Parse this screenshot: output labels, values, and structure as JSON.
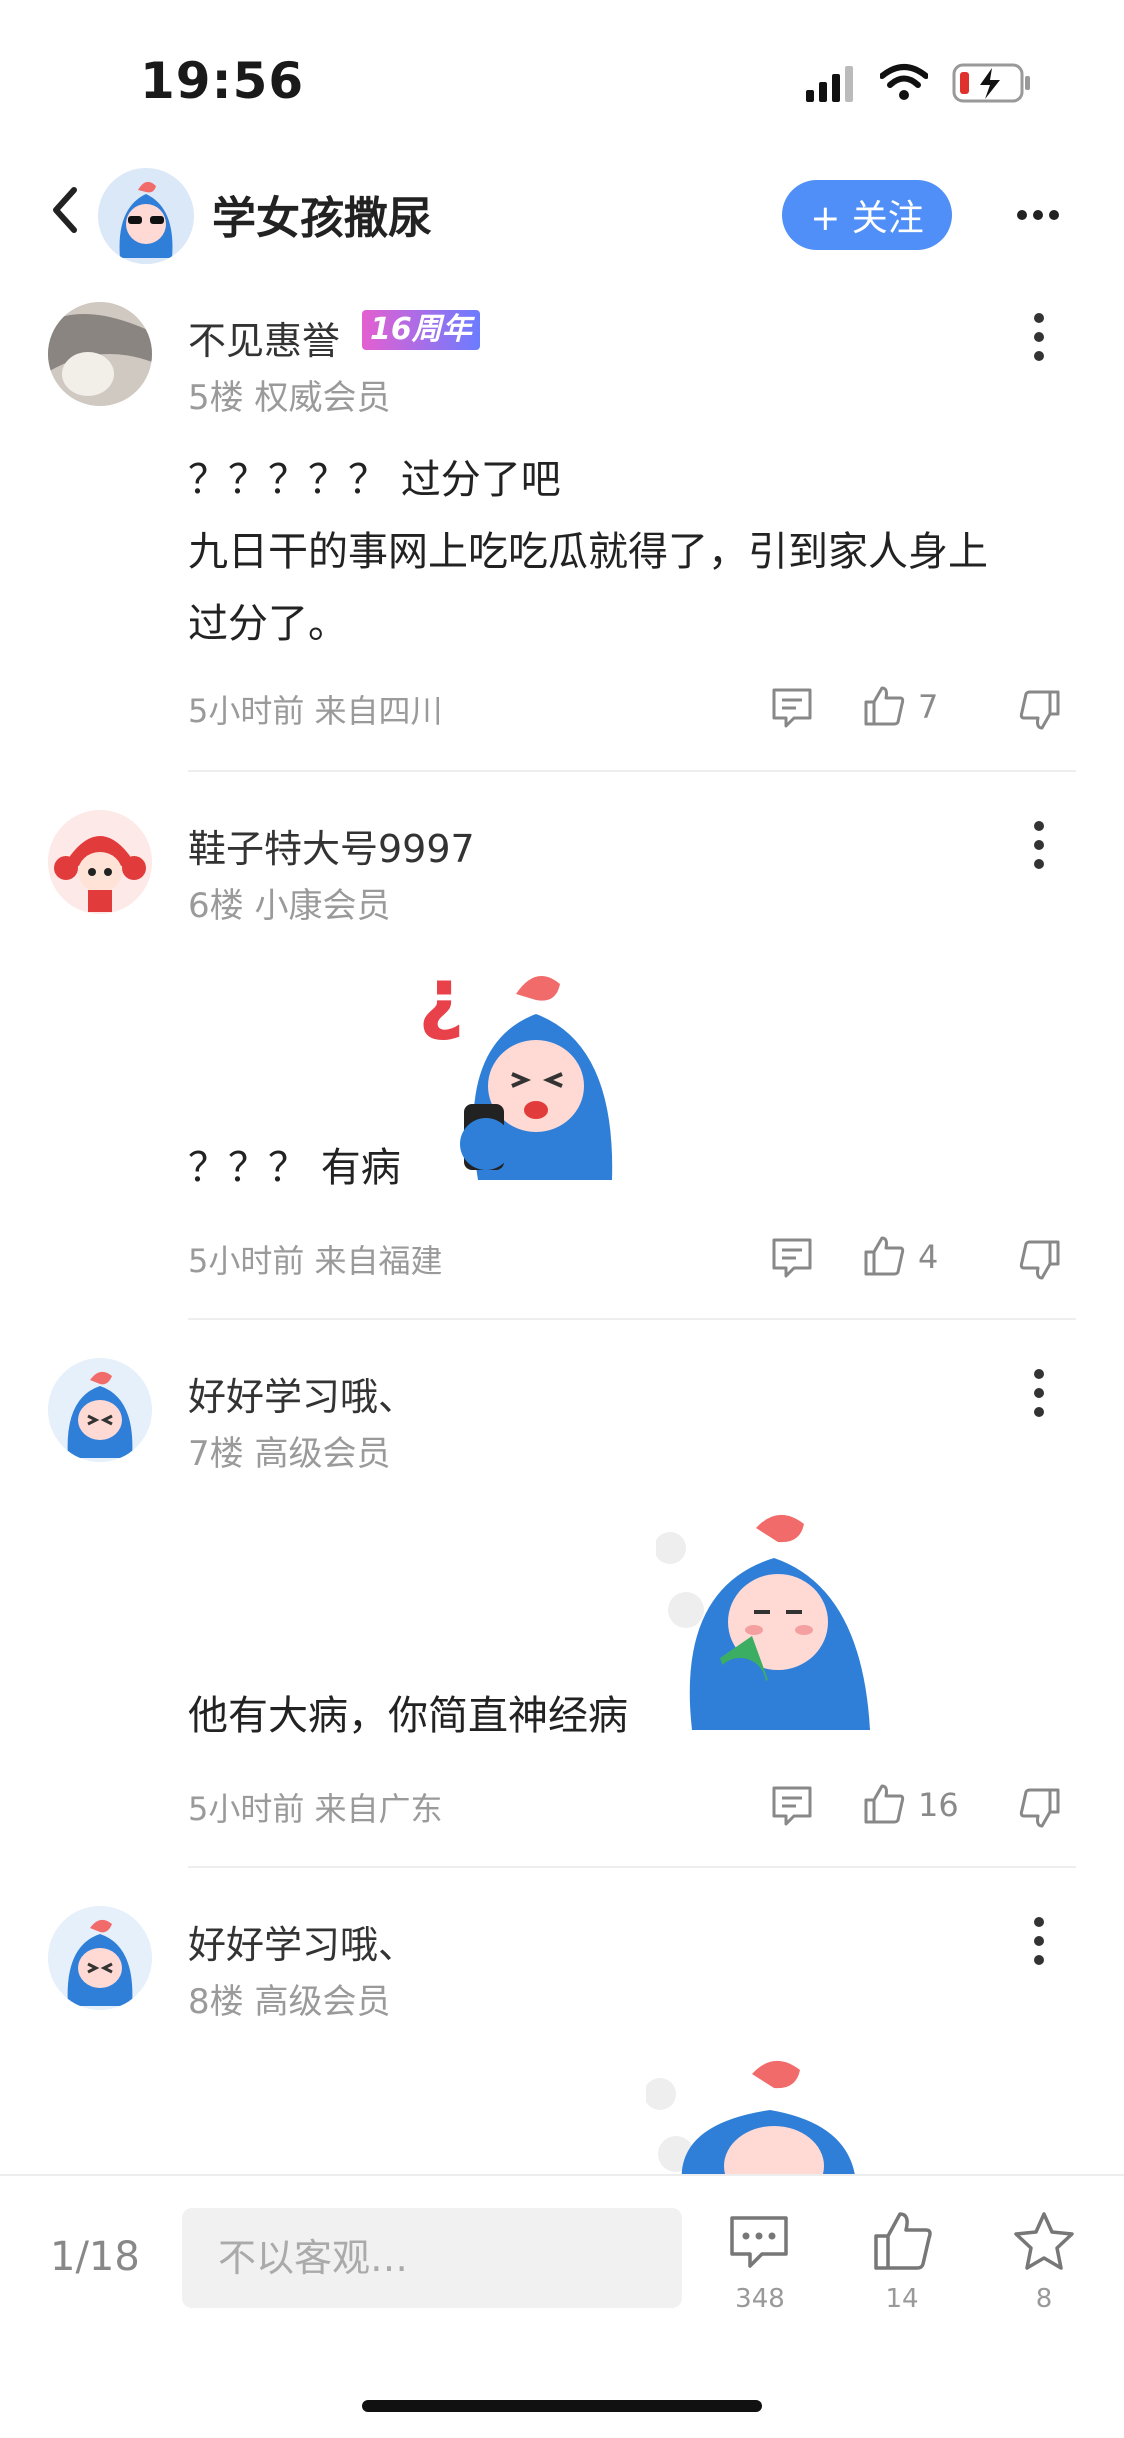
{
  "status_bar": {
    "time": "19:56"
  },
  "header": {
    "title": "学女孩撒尿",
    "follow_label": "+ 关注"
  },
  "posts": [
    {
      "username": "不见惠誉",
      "badge": "16周年",
      "meta": "5楼 权威会员",
      "text_lines": [
        "？？？？？ 过分了吧",
        "九日干的事网上吃吃瓜就得了，引到家人身上",
        "过分了。"
      ],
      "footer": "5小时前 来自四川",
      "likes": "7"
    },
    {
      "username": "鞋子特大号9997",
      "meta": "6楼 小康会员",
      "text": "？？？ 有病",
      "footer": "5小时前 来自福建",
      "likes": "4"
    },
    {
      "username": "好好学习哦、",
      "meta": "7楼 高级会员",
      "text": "他有大病，你简直神经病",
      "footer": "5小时前 来自广东",
      "likes": "16"
    },
    {
      "username": "好好学习哦、",
      "meta": "8楼 高级会员"
    }
  ],
  "bottom": {
    "page": "1/18",
    "reply_placeholder": "不以客观…",
    "comments_count": "348",
    "likes_count": "14",
    "favorites_count": "8"
  },
  "colors": {
    "accent": "#4f8ff7",
    "badge_from": "#e45fd0",
    "badge_to": "#6b7cff"
  },
  "icons": [
    "back-arrow-icon",
    "more-horizontal-icon",
    "more-vertical-icon",
    "comment-icon",
    "thumb-up-icon",
    "thumb-down-icon",
    "star-icon"
  ]
}
